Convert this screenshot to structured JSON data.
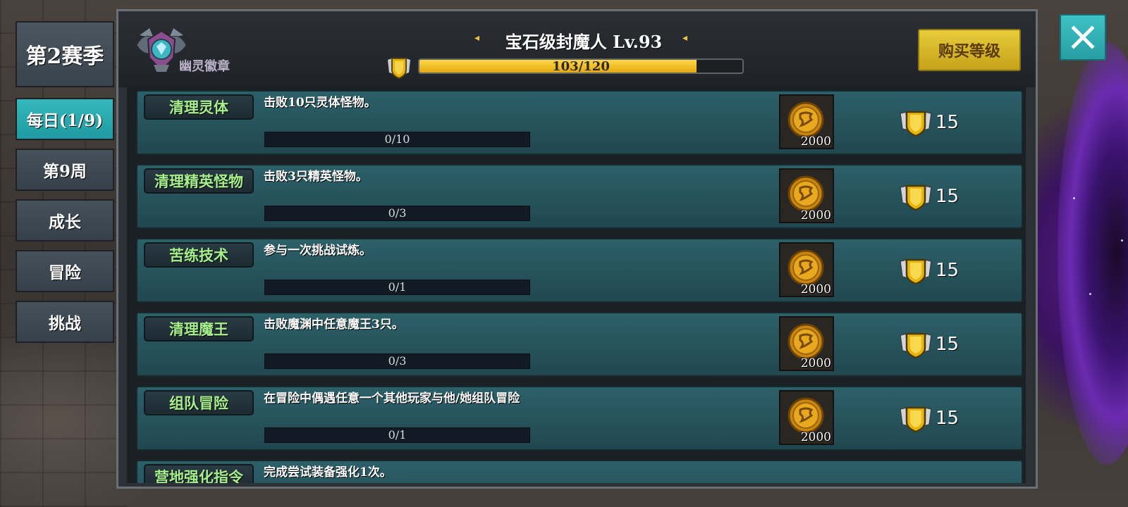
{
  "season": {
    "label": "第2赛季"
  },
  "tabs": [
    {
      "label": "每日(1/9)",
      "active": true
    },
    {
      "label": "第9周",
      "active": false
    },
    {
      "label": "成长",
      "active": false
    },
    {
      "label": "冒险",
      "active": false
    },
    {
      "label": "挑战",
      "active": false
    }
  ],
  "header": {
    "emblem_label": "幽灵徽章",
    "rank_title": "宝石级封魔人  Lv.93",
    "xp_text": "103/120",
    "xp_fraction": 0.858,
    "buy_label": "购买等级"
  },
  "tasks": [
    {
      "name": "清理灵体",
      "desc": "击败10只灵体怪物。",
      "progress": "0/10",
      "coin": "2000",
      "xp": "15"
    },
    {
      "name": "清理精英怪物",
      "desc": "击败3只精英怪物。",
      "progress": "0/3",
      "coin": "2000",
      "xp": "15"
    },
    {
      "name": "苦练技术",
      "desc": "参与一次挑战试炼。",
      "progress": "0/1",
      "coin": "2000",
      "xp": "15"
    },
    {
      "name": "清理魔王",
      "desc": "击败魔渊中任意魔王3只。",
      "progress": "0/3",
      "coin": "2000",
      "xp": "15"
    },
    {
      "name": "组队冒险",
      "desc": "在冒险中偶遇任意一个其他玩家与他/她组队冒险",
      "progress": "0/1",
      "coin": "2000",
      "xp": "15"
    },
    {
      "name": "营地强化指令",
      "desc": "完成尝试装备强化1次。",
      "progress": "",
      "coin": "",
      "xp": ""
    }
  ],
  "colors": {
    "accent_teal": "#2fb0b6",
    "gold": "#e3b51c",
    "task_name_green": "#a5f08c"
  },
  "icons": {
    "close": "close-icon",
    "emblem": "ghost-badge-emblem-icon",
    "xp": "xp-shield-icon",
    "coin": "gold-coin-icon"
  }
}
